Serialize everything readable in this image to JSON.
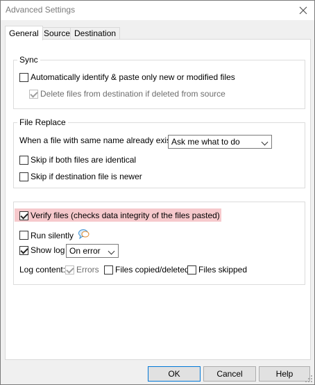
{
  "window": {
    "title": "Advanced Settings"
  },
  "tabs": [
    {
      "label": "General",
      "active": true
    },
    {
      "label": "Source",
      "active": false
    },
    {
      "label": "Destination",
      "active": false
    }
  ],
  "sync": {
    "legend": "Sync",
    "auto_identify_label": "Automatically identify & paste only new or modified files",
    "delete_files_label": "Delete files from destination if deleted from source"
  },
  "file_replace": {
    "legend": "File Replace",
    "exists_label": "When a file with same name already exists:",
    "exists_value": "Ask me what to do",
    "skip_identical_label": "Skip if both files are identical",
    "skip_newer_label": "Skip if destination file is newer"
  },
  "options": {
    "verify_label": "Verify files (checks data integrity of the files pasted)",
    "run_silently_label": "Run silently",
    "show_log_label": "Show log",
    "show_log_value": "On error",
    "log_content_label": "Log content:",
    "errors_label": "Errors",
    "files_copied_label": "Files copied/deleted",
    "files_skipped_label": "Files skipped"
  },
  "buttons": {
    "ok": "OK",
    "cancel": "Cancel",
    "help": "Help"
  },
  "icons": {
    "close": "close-icon",
    "bubble": "chat-bubble-icon",
    "grip": "resize-grip-icon"
  },
  "colors": {
    "highlight": "#f6c9cc",
    "accent": "#0078d7"
  }
}
